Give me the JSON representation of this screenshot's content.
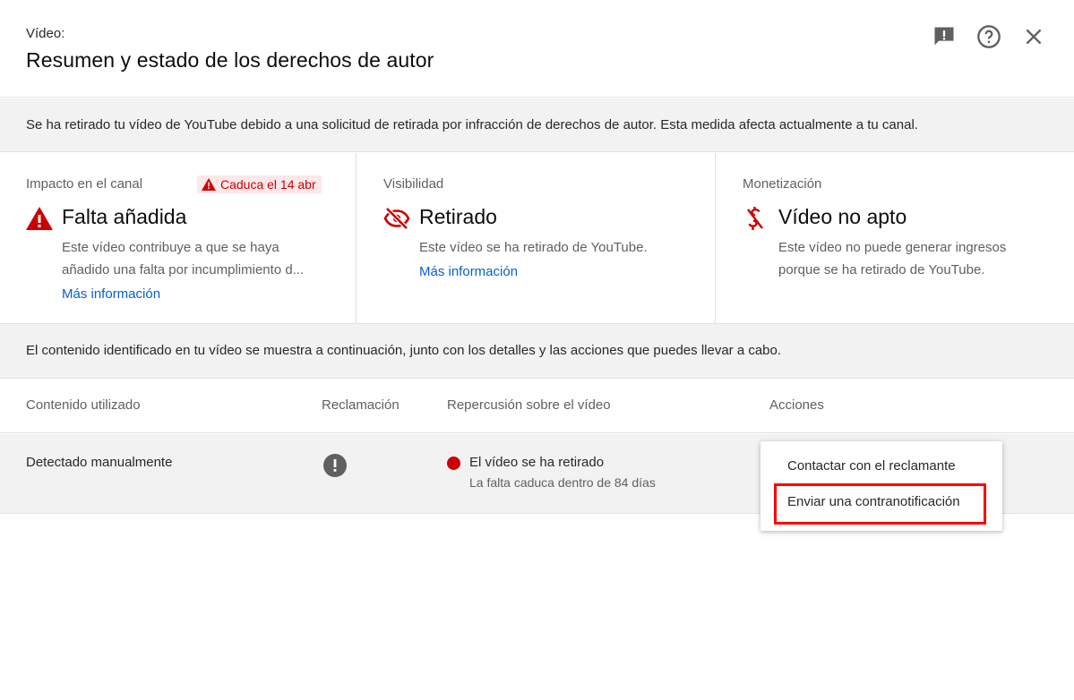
{
  "header": {
    "eyebrow": "Vídeo:",
    "title": "Resumen y estado de los derechos de autor",
    "icons": [
      "feedback-icon",
      "help-icon",
      "close-icon"
    ]
  },
  "banner": {
    "text": "Se ha retirado tu vídeo de YouTube debido a una solicitud de retirada por infracción de derechos de autor. Esta medida afecta actualmente a tu canal."
  },
  "cards": {
    "impact": {
      "label": "Impacto en el canal",
      "chip": "Caduca el 14 abr",
      "state": "Falta añadida",
      "desc_line1": "Este vídeo contribuye a que se haya",
      "desc_line2": "añadido una falta por incumplimiento d...",
      "link": "Más información"
    },
    "visibility": {
      "label": "Visibilidad",
      "state": "Retirado",
      "desc": "Este vídeo se ha retirado de YouTube.",
      "link": "Más información"
    },
    "monetization": {
      "label": "Monetización",
      "state": "Vídeo no apto",
      "desc_line1": "Este vídeo no puede generar ingresos",
      "desc_line2": "porque se ha retirado de YouTube."
    }
  },
  "info": {
    "text": "El contenido identificado en tu vídeo se muestra a continuación, junto con los detalles y las acciones que puedes llevar a cabo."
  },
  "table": {
    "headers": [
      "Contenido utilizado",
      "Reclamación",
      "Repercusión sobre el vídeo",
      "Acciones"
    ],
    "rows": [
      {
        "content": "Detectado manualmente",
        "impact": "El vídeo se ha retirado",
        "impact_sub": "La falta caduca dentro de 84 días"
      }
    ]
  },
  "menu": {
    "items": [
      "Contactar con el reclamante",
      "Enviar una contranotificación"
    ],
    "highlighted_index": 1
  },
  "colors": {
    "accent_red": "#cc0000",
    "link_blue": "#065fd4",
    "highlight_border": "#ff0000"
  }
}
